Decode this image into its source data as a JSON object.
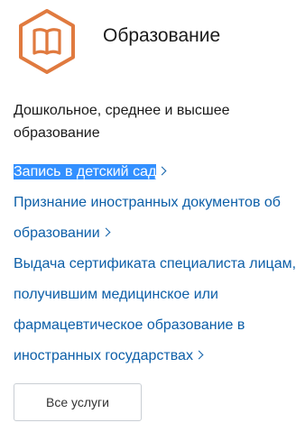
{
  "category": {
    "icon": "open-book-icon",
    "accent_color": "#e07a3f",
    "title": "Образование",
    "description": "Дошкольное, среднее и высшее образование"
  },
  "links": [
    {
      "label": "Запись в детский сад",
      "selected": true
    },
    {
      "label": "Признание иностранных документов об образовании",
      "selected": false
    },
    {
      "label": "Выдача сертификата специалиста лицам, получившим медицинское или фармацевтическое образование в иностранных государствах",
      "selected": false
    }
  ],
  "all_services_button": {
    "label": "Все услуги"
  },
  "colors": {
    "link": "#0d5fa8",
    "selection": "#3390ff",
    "text": "#1a1a1a"
  }
}
